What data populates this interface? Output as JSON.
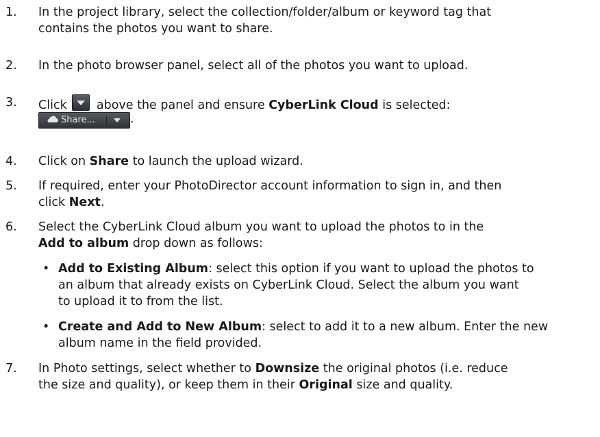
{
  "steps": [
    {
      "num": "1.",
      "lines": [
        "In the project library, select the collection/folder/album or keyword tag that",
        "contains the photos you want to share."
      ]
    },
    {
      "num": "2.",
      "text": "In the photo browser panel, select all of the photos you want to upload."
    },
    {
      "num": "3.",
      "pre": "Click",
      "mid": "above the panel and ensure",
      "bold": "CyberLink Cloud",
      "post": "is selected:",
      "share_label": "Share...",
      "period": "."
    },
    {
      "num": "4.",
      "pre": "Click on",
      "bold": "Share",
      "post": "to launch the upload wizard."
    },
    {
      "num": "5.",
      "line1": "If required, enter your PhotoDirector account information to sign in, and then",
      "pre": "click",
      "bold": "Next",
      "post": "."
    },
    {
      "num": "6.",
      "line1": "Select the CyberLink Cloud album you want to upload the photos to in the",
      "bold": "Add to album",
      "post": "drop down as follows:"
    },
    {
      "num": "7.",
      "pre": "In Photo settings, select whether to",
      "bold1": "Downsize",
      "mid": "the original photos (i.e. reduce",
      "line2pre": "the size and quality), or keep them in their",
      "bold2": "Original",
      "post": "size and quality."
    }
  ],
  "bullets": [
    {
      "bold": "Add to Existing Album",
      "line1": ": select this option if you want to upload the photos to",
      "line2": "an album that already exists on CyberLink Cloud. Select the album you want",
      "line3": "to upload it to from the list."
    },
    {
      "bold": "Create and Add to New Album",
      "line1": ": select to add it to a new album. Enter the new",
      "line2": "album name in the field provided."
    }
  ],
  "icons": {
    "dropdown": "dropdown-arrow-icon",
    "cloud": "cloud-icon"
  },
  "colors": {
    "button_dark": "#2b2f33",
    "text": "#1a1a1a"
  }
}
